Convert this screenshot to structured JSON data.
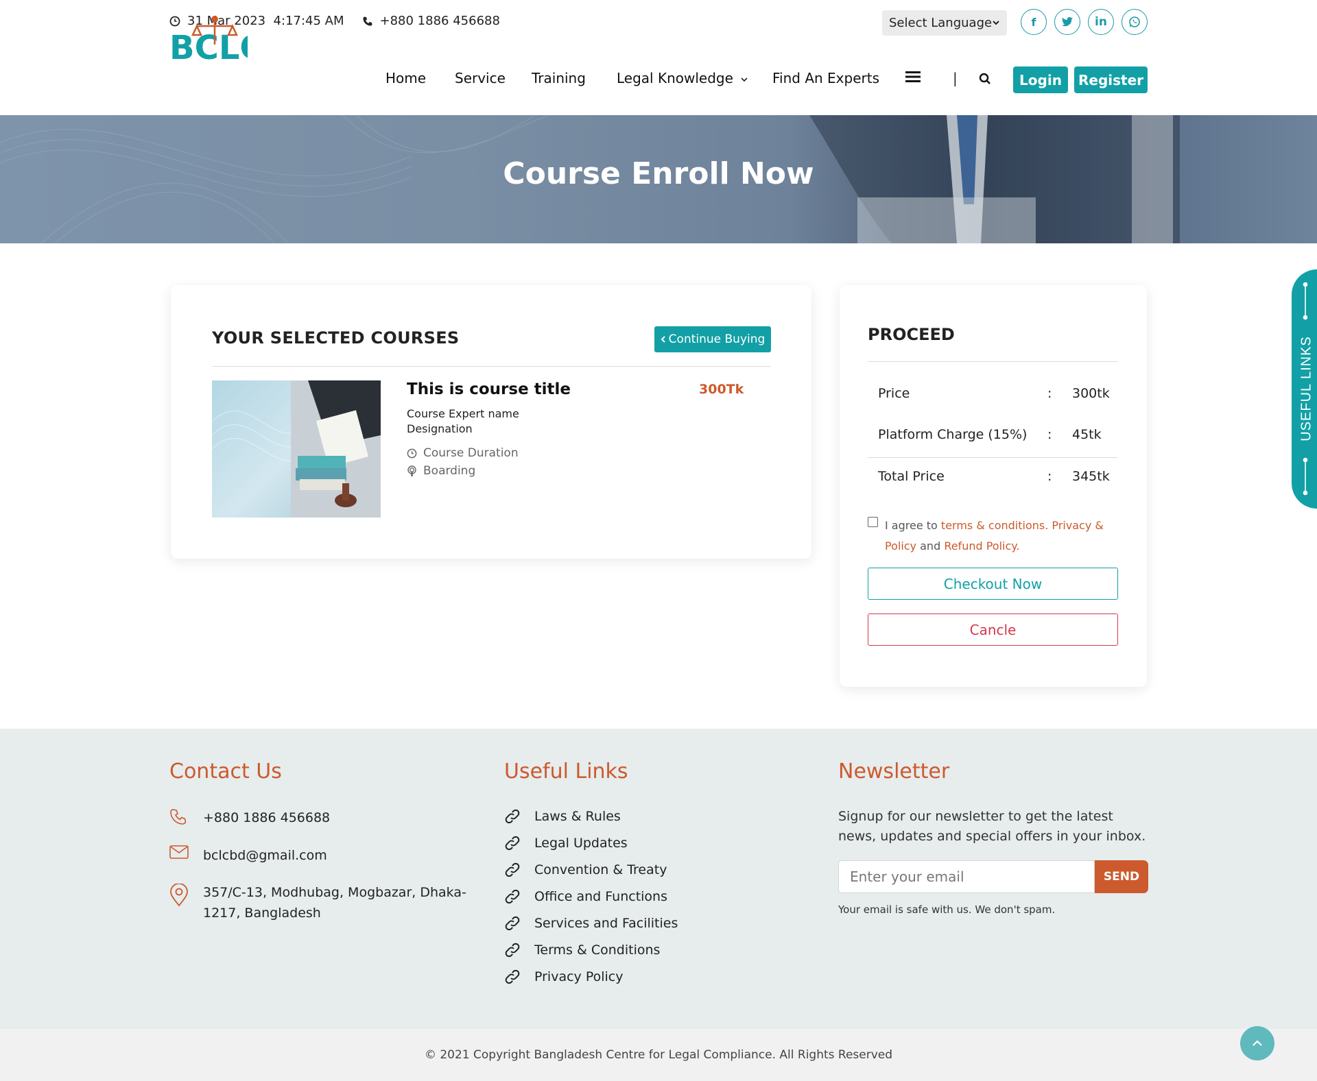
{
  "topbar": {
    "datetime": "31 Mar 2023  4:17:45 AM",
    "phone": "+880 1886 456688",
    "language": "Select Language",
    "social_icons": [
      "facebook-icon",
      "twitter-icon",
      "linkedin-icon",
      "whatsapp-icon"
    ]
  },
  "nav": {
    "logo_text": "BCLC",
    "items": [
      "Home",
      "Service",
      "Training",
      "Legal Knowledge",
      "Find An Experts"
    ],
    "login": "Login",
    "register": "Register"
  },
  "hero": {
    "title": "Course Enroll Now"
  },
  "selected": {
    "heading": "YOUR SELECTED COURSES",
    "continue": "Continue Buying",
    "course": {
      "title": "This is course title",
      "price": "300Tk",
      "expert": "Course Expert name",
      "designation": "Designation",
      "duration": "Course Duration",
      "boarding": "Boarding"
    }
  },
  "proceed": {
    "heading": "PROCEED",
    "rows": [
      {
        "label": "Price",
        "sep": ":",
        "value": "300tk"
      },
      {
        "label": "Platform Charge (15%)",
        "sep": ":",
        "value": "45tk"
      },
      {
        "label": "Total Price",
        "sep": ":",
        "value": "345tk"
      }
    ],
    "agree_prefix": "I agree to ",
    "terms": "terms & conditions",
    "dot1": ". ",
    "privacy": "Privacy & Policy",
    "and": " and ",
    "refund": "Refund Policy",
    "dot2": ".",
    "checkout": "Checkout Now",
    "cancel": "Cancle"
  },
  "side_tab": {
    "label": "USEFUL LINKS"
  },
  "footer": {
    "contact_heading": "Contact Us",
    "phone": "+880 1886 456688",
    "email": "bclcbd@gmail.com",
    "address": "357/C-13, Modhubag, Mogbazar, Dhaka-1217, Bangladesh",
    "links_heading": "Useful Links",
    "links": [
      "Laws & Rules",
      "Legal Updates",
      "Convention & Treaty",
      "Office and Functions",
      "Services and Facilities",
      "Terms & Conditions",
      "Privacy Policy"
    ],
    "newsletter_heading": "Newsletter",
    "newsletter_text": "Signup for our newsletter to get the latest news, updates and special offers in your inbox.",
    "email_placeholder": "Enter your email",
    "send": "SEND",
    "note": "Your email is safe with us. We don't spam."
  },
  "copyright": "© 2021 Copyright Bangladesh Centre for Legal Compliance. All Rights Reserved",
  "colors": {
    "teal": "#12a0a6",
    "orange": "#cc5a2d",
    "red": "#d23a4c"
  }
}
